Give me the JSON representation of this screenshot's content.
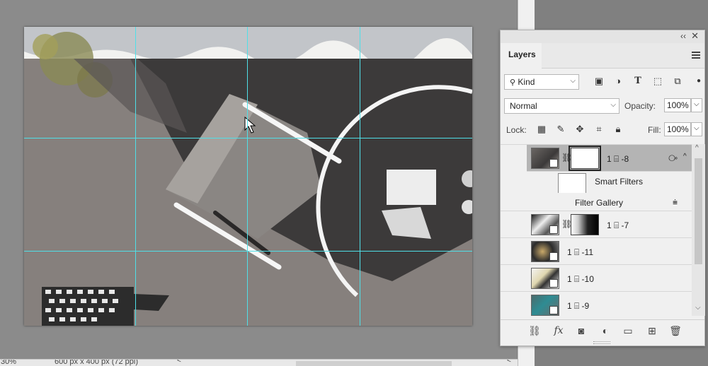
{
  "document": {
    "zoom": "30%",
    "size_info": "600 px x 400 px (72 ppi)"
  },
  "colors": {
    "guide": "#4fe0e8",
    "selected_layer": "#b4b4b4"
  },
  "layers_panel": {
    "tab_label": "Layers",
    "collapse_icon": "double-chevron-left-icon",
    "close_icon": "close-icon",
    "filter": {
      "kind_label": "Kind",
      "icons": [
        "image-filter-icon",
        "adjustment-filter-icon",
        "type-filter-icon",
        "shape-filter-icon",
        "smart-object-filter-icon"
      ]
    },
    "blend_mode": "Normal",
    "opacity_label": "Opacity:",
    "opacity_value": "100%",
    "lock_label": "Lock:",
    "fill_label": "Fill:",
    "fill_value": "100%",
    "layers": [
      {
        "name": "1 ⌸ -8",
        "visible": true,
        "selected": true,
        "has_mask": true
      },
      {
        "name": "Smart Filters",
        "type": "smart-filters"
      },
      {
        "name": "Filter Gallery",
        "type": "filter"
      },
      {
        "name": "1 ⌸ -7",
        "visible": true,
        "has_mask": true
      },
      {
        "name": "1 ⌸ -11",
        "visible": false
      },
      {
        "name": "1 ⌸ -10",
        "visible": false
      },
      {
        "name": "1 ⌸ -9",
        "visible": false
      }
    ],
    "bottom_icons": [
      "link-layers-icon",
      "fx-icon",
      "add-mask-icon",
      "adjustment-layer-icon",
      "group-folder-icon",
      "new-layer-icon",
      "trash-icon"
    ]
  }
}
